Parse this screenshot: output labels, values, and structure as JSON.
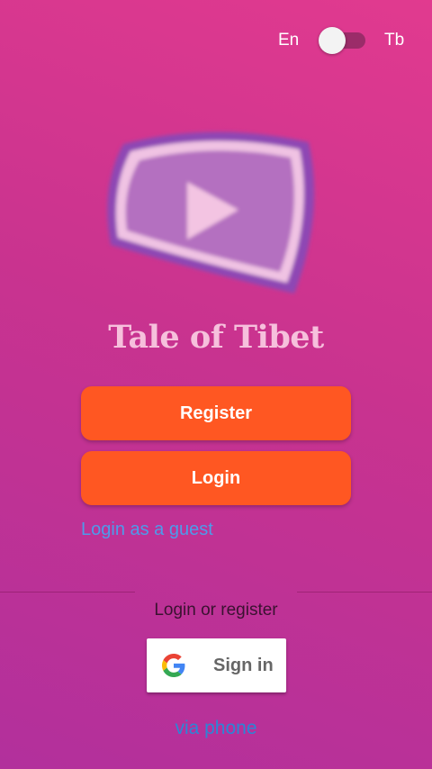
{
  "language": {
    "left_label": "En",
    "right_label": "Tb",
    "state": "En"
  },
  "logo": {
    "icon": "play-video-icon"
  },
  "app": {
    "title": "Tale of Tibet"
  },
  "buttons": {
    "register_label": "Register",
    "login_label": "Login"
  },
  "links": {
    "guest_label": "Login as a guest",
    "phone_label": "via phone"
  },
  "social": {
    "divider_label": "Login or register",
    "google_label": "Sign in",
    "google_icon": "google-icon"
  },
  "colors": {
    "background_top": "#e13a8f",
    "background_bottom": "#b2309c",
    "primary_button": "#ff5722",
    "title": "#f6c0dc",
    "link": "#4e9bea"
  }
}
